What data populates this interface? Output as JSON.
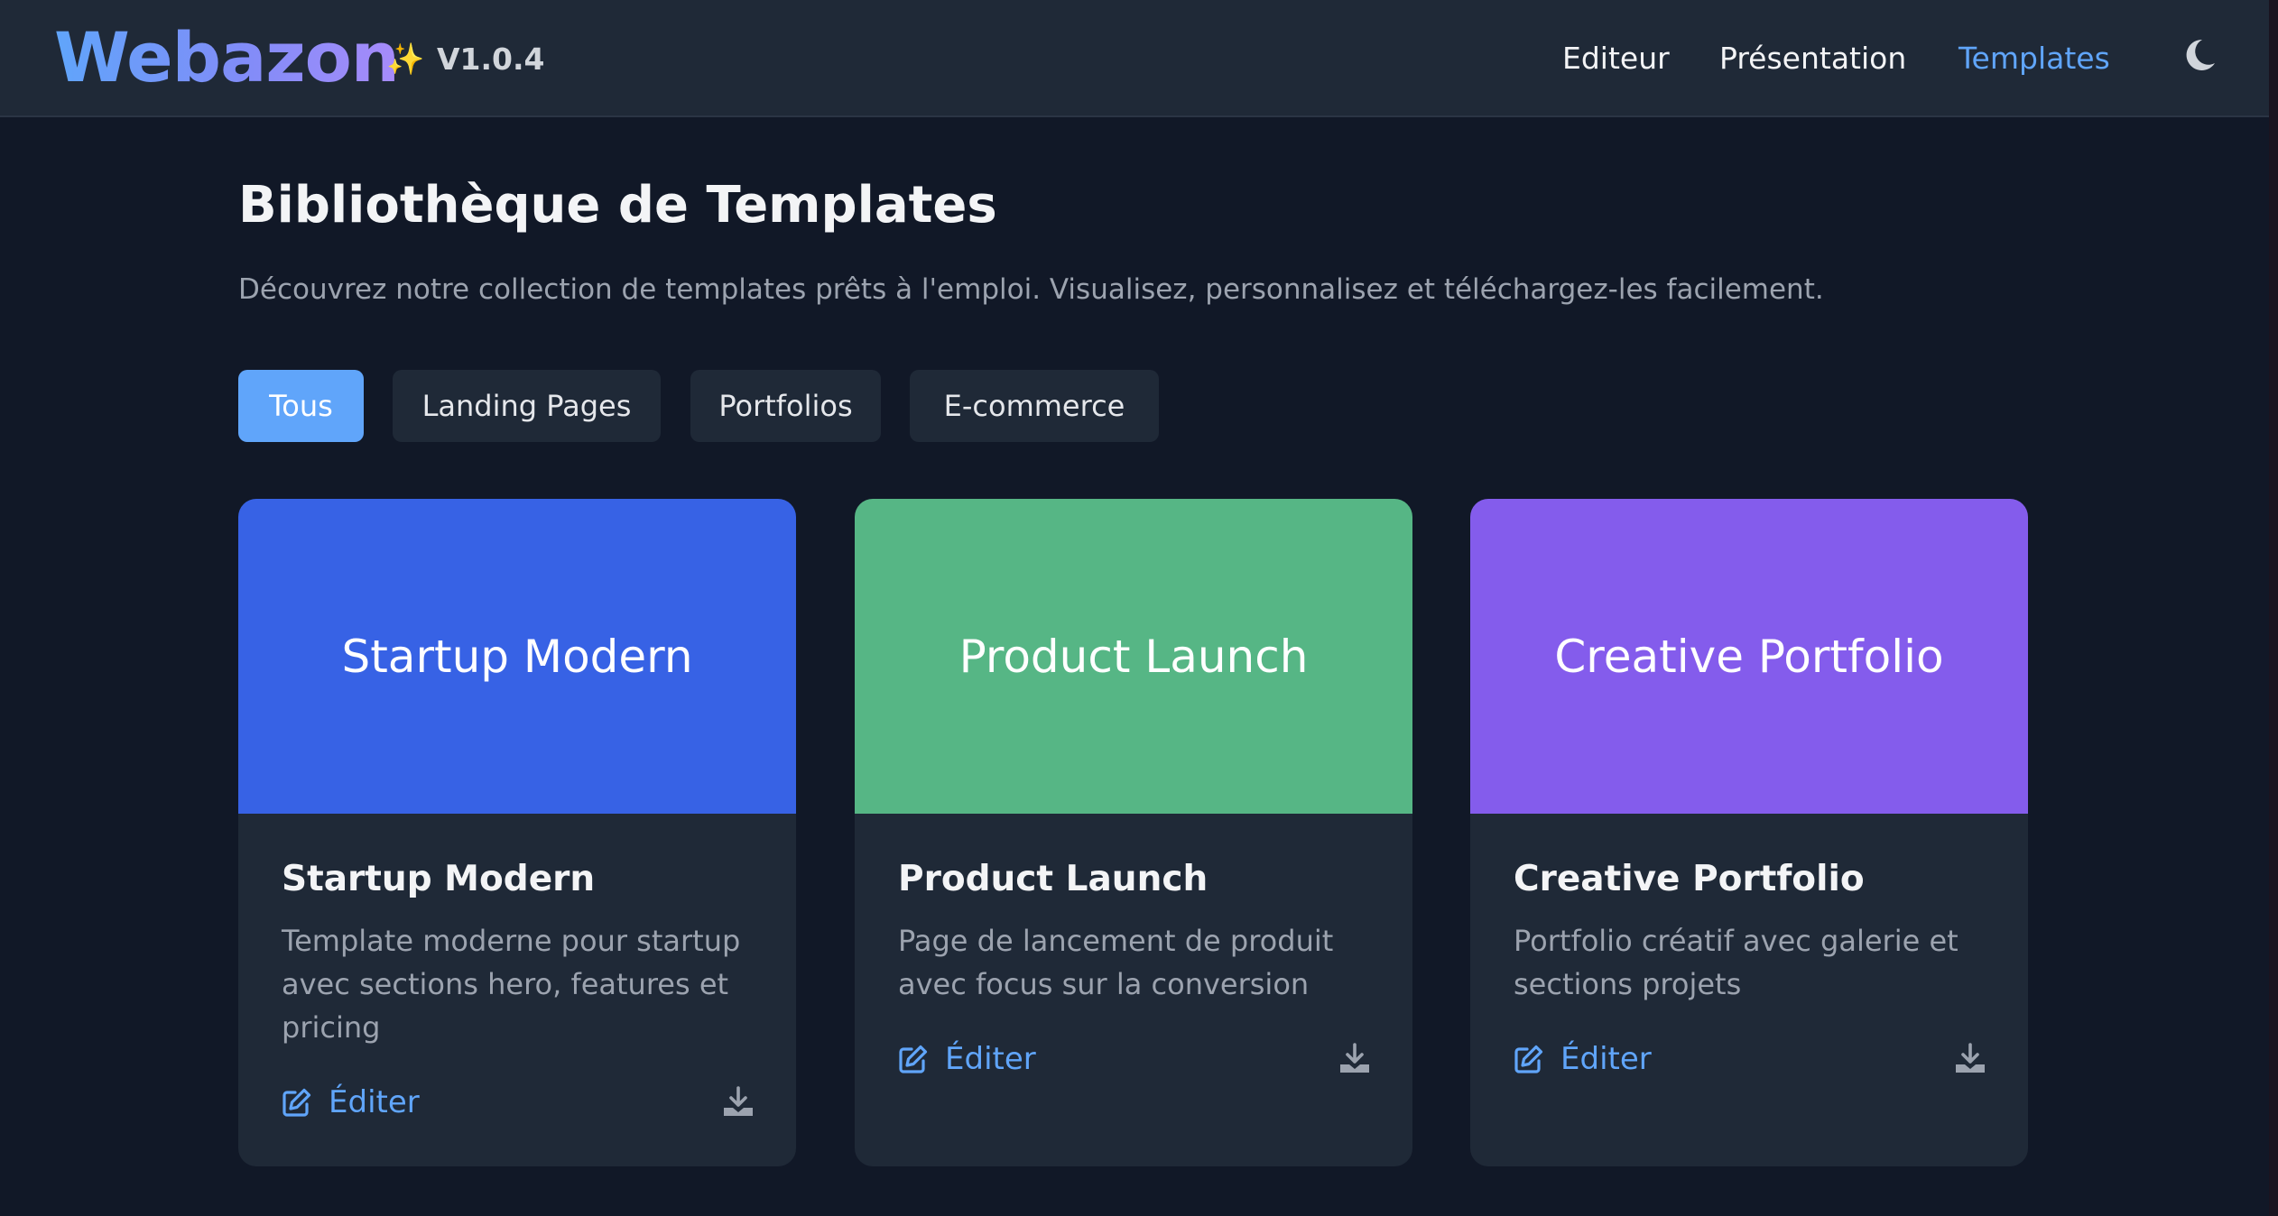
{
  "colors": {
    "background": "#111827",
    "surface": "#1f2937",
    "accent": "#60a5fa",
    "card_blue": "#3762e5",
    "card_green": "#56b685",
    "card_purple": "#845cec"
  },
  "header": {
    "logo": "Webazon",
    "sparkle": "✨",
    "version": "V1.0.4",
    "nav": [
      {
        "label": "Editeur"
      },
      {
        "label": "Présentation"
      },
      {
        "label": "Templates",
        "active": true
      }
    ],
    "theme_icon": "moon-icon"
  },
  "main": {
    "title": "Bibliothèque de Templates",
    "subtitle": "Découvrez notre collection de templates prêts à l'emploi. Visualisez, personnalisez et téléchargez-les facilement.",
    "filters": [
      {
        "label": "Tous",
        "active": true
      },
      {
        "label": "Landing Pages"
      },
      {
        "label": "Portfolios"
      },
      {
        "label": "E-commerce"
      }
    ],
    "cards": [
      {
        "preview_title": "Startup Modern",
        "preview_color": "#3762e5",
        "title": "Startup Modern",
        "description": "Template moderne pour startup avec sections hero, features et pricing",
        "edit_label": "Éditer",
        "edit_icon": "edit-icon",
        "download_icon": "download-icon"
      },
      {
        "preview_title": "Product Launch",
        "preview_color": "#56b685",
        "title": "Product Launch",
        "description": "Page de lancement de produit avec focus sur la conversion",
        "edit_label": "Éditer",
        "edit_icon": "edit-icon",
        "download_icon": "download-icon"
      },
      {
        "preview_title": "Creative Portfolio",
        "preview_color": "#845cec",
        "title": "Creative Portfolio",
        "description": "Portfolio créatif avec galerie et sections projets",
        "edit_label": "Éditer",
        "edit_icon": "edit-icon",
        "download_icon": "download-icon"
      }
    ]
  }
}
